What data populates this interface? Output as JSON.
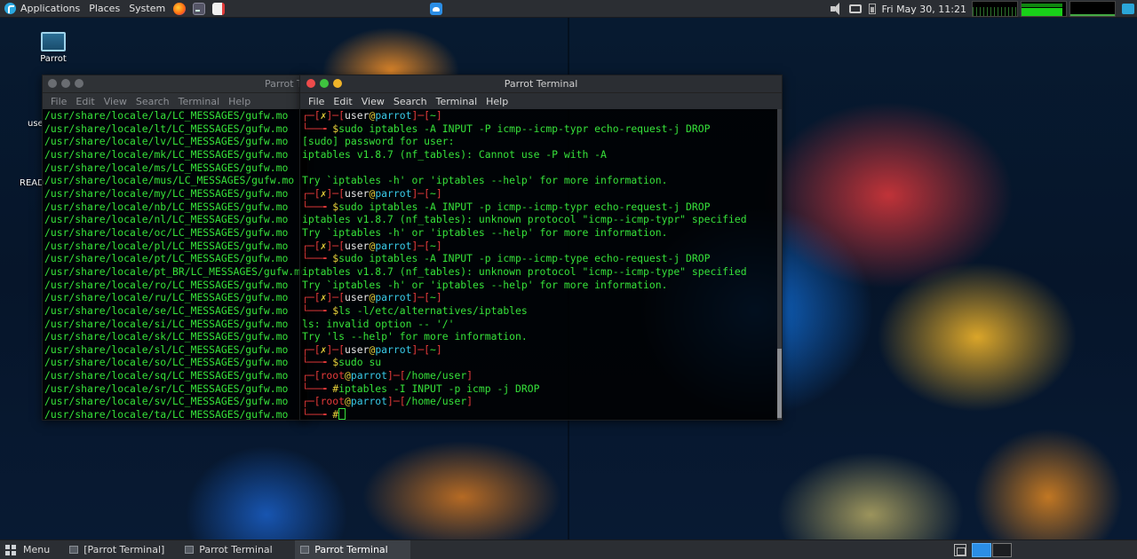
{
  "top_panel": {
    "applications": "Applications",
    "places": "Places",
    "system": "System",
    "clock": "Fri May 30, 11:21",
    "mem_fraction": 0.92
  },
  "desktop": {
    "icons": [
      {
        "label": "Parrot"
      }
    ],
    "fragments": [
      "use",
      "READ"
    ]
  },
  "back_terminal": {
    "title": "Parrot Te",
    "menu": [
      "File",
      "Edit",
      "View",
      "Search",
      "Terminal",
      "Help"
    ],
    "lines": [
      "/usr/share/locale/la/LC_MESSAGES/gufw.mo",
      "/usr/share/locale/lt/LC_MESSAGES/gufw.mo",
      "/usr/share/locale/lv/LC_MESSAGES/gufw.mo",
      "/usr/share/locale/mk/LC_MESSAGES/gufw.mo",
      "/usr/share/locale/ms/LC_MESSAGES/gufw.mo",
      "/usr/share/locale/mus/LC_MESSAGES/gufw.mo",
      "/usr/share/locale/my/LC_MESSAGES/gufw.mo",
      "/usr/share/locale/nb/LC_MESSAGES/gufw.mo",
      "/usr/share/locale/nl/LC_MESSAGES/gufw.mo",
      "/usr/share/locale/oc/LC_MESSAGES/gufw.mo",
      "/usr/share/locale/pl/LC_MESSAGES/gufw.mo",
      "/usr/share/locale/pt/LC_MESSAGES/gufw.mo",
      "/usr/share/locale/pt_BR/LC_MESSAGES/gufw.mo",
      "/usr/share/locale/ro/LC_MESSAGES/gufw.mo",
      "/usr/share/locale/ru/LC_MESSAGES/gufw.mo",
      "/usr/share/locale/se/LC_MESSAGES/gufw.mo",
      "/usr/share/locale/si/LC_MESSAGES/gufw.mo",
      "/usr/share/locale/sk/LC_MESSAGES/gufw.mo",
      "/usr/share/locale/sl/LC_MESSAGES/gufw.mo",
      "/usr/share/locale/so/LC_MESSAGES/gufw.mo",
      "/usr/share/locale/sq/LC_MESSAGES/gufw.mo",
      "/usr/share/locale/sr/LC_MESSAGES/gufw.mo",
      "/usr/share/locale/sv/LC_MESSAGES/gufw.mo",
      "/usr/share/locale/ta/LC_MESSAGES/gufw.mo"
    ]
  },
  "front_terminal": {
    "title": "Parrot Terminal",
    "menu": [
      "File",
      "Edit",
      "View",
      "Search",
      "Terminal",
      "Help"
    ],
    "lines": [
      {
        "type": "prompt",
        "status": "✗",
        "user": "user",
        "host": "parrot",
        "dir": "~"
      },
      {
        "type": "cmd",
        "sym": "$",
        "text": "sudo iptables -A INPUT -P icmp--icmp-typr echo-request-j DROP"
      },
      {
        "type": "out",
        "text": "[sudo] password for user:"
      },
      {
        "type": "out",
        "text": "iptables v1.8.7 (nf_tables): Cannot use -P with -A"
      },
      {
        "type": "out",
        "text": ""
      },
      {
        "type": "out",
        "text": "Try `iptables -h' or 'iptables --help' for more information."
      },
      {
        "type": "prompt",
        "status": "✗",
        "user": "user",
        "host": "parrot",
        "dir": "~"
      },
      {
        "type": "cmd",
        "sym": "$",
        "text": "sudo iptables -A INPUT -p icmp--icmp-typr echo-request-j DROP"
      },
      {
        "type": "out",
        "text": "iptables v1.8.7 (nf_tables): unknown protocol \"icmp--icmp-typr\" specified"
      },
      {
        "type": "out",
        "text": "Try `iptables -h' or 'iptables --help' for more information."
      },
      {
        "type": "prompt",
        "status": "✗",
        "user": "user",
        "host": "parrot",
        "dir": "~"
      },
      {
        "type": "cmd",
        "sym": "$",
        "text": "sudo iptables -A INPUT -p icmp--icmp-type echo-request-j DROP"
      },
      {
        "type": "out",
        "text": "iptables v1.8.7 (nf_tables): unknown protocol \"icmp--icmp-type\" specified"
      },
      {
        "type": "out",
        "text": "Try `iptables -h' or 'iptables --help' for more information."
      },
      {
        "type": "prompt",
        "status": "✗",
        "user": "user",
        "host": "parrot",
        "dir": "~"
      },
      {
        "type": "cmd",
        "sym": "$",
        "text": "ls -l/etc/alternatives/iptables"
      },
      {
        "type": "out",
        "text": "ls: invalid option -- '/'"
      },
      {
        "type": "out",
        "text": "Try 'ls --help' for more information."
      },
      {
        "type": "prompt",
        "status": "✗",
        "user": "user",
        "host": "parrot",
        "dir": "~"
      },
      {
        "type": "cmd",
        "sym": "$",
        "text": "sudo su"
      },
      {
        "type": "root",
        "user": "root",
        "host": "parrot",
        "dir": "/home/user"
      },
      {
        "type": "cmd",
        "sym": "#",
        "text": "iptables -I INPUT -p icmp -j DROP"
      },
      {
        "type": "root",
        "user": "root",
        "host": "parrot",
        "dir": "/home/user"
      },
      {
        "type": "cursor",
        "sym": "#",
        "text": ""
      }
    ]
  },
  "taskbar": {
    "menu": "Menu",
    "tasks": [
      {
        "label": "[Parrot Terminal]",
        "active": false
      },
      {
        "label": "Parrot Terminal",
        "active": false
      },
      {
        "label": "Parrot Terminal",
        "active": true
      }
    ]
  },
  "colors": {
    "terminal_green": "#36e23a",
    "prompt_red": "#e53a3a",
    "host_cyan": "#38c9e6",
    "status_yellow": "#e8d13a",
    "panel_bg": "#2b2e33"
  }
}
